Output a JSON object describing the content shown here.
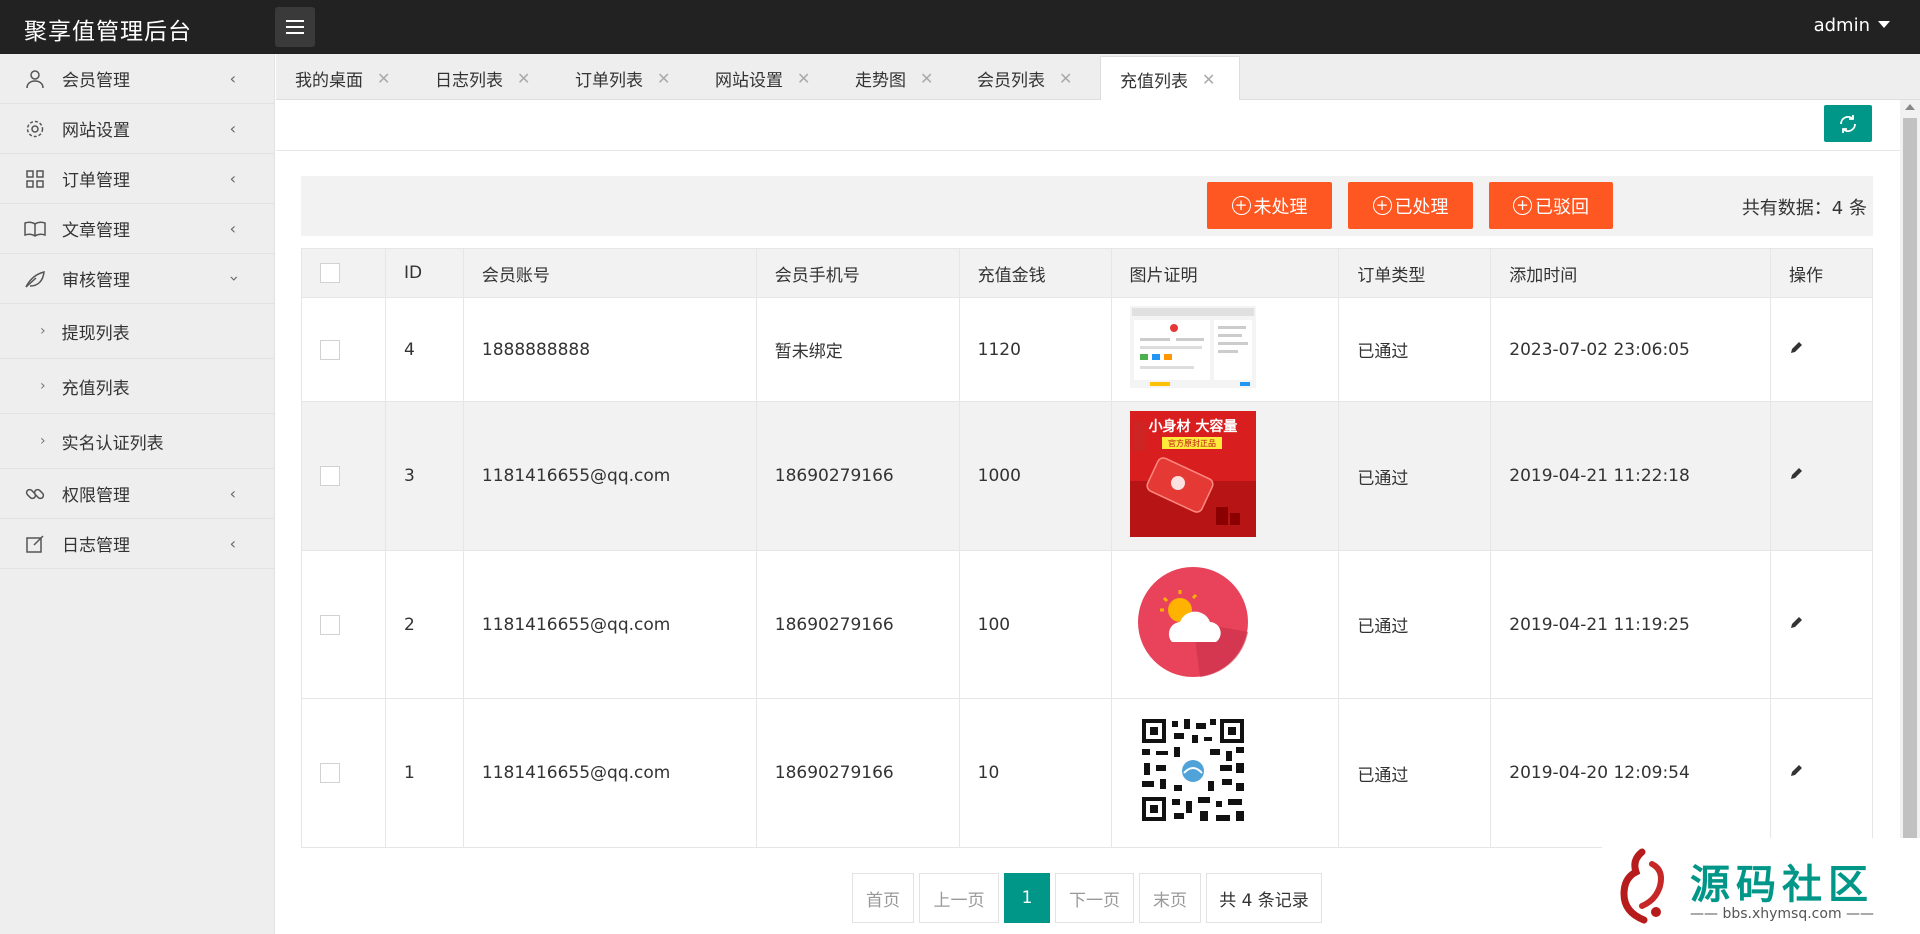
{
  "header": {
    "brand": "聚享值管理后台",
    "user": "admin"
  },
  "sidebar": {
    "items": [
      {
        "label": "会员管理"
      },
      {
        "label": "网站设置"
      },
      {
        "label": "订单管理"
      },
      {
        "label": "文章管理"
      },
      {
        "label": "审核管理"
      },
      {
        "label": "权限管理"
      },
      {
        "label": "日志管理"
      }
    ],
    "subitems": [
      {
        "label": "提现列表"
      },
      {
        "label": "充值列表"
      },
      {
        "label": "实名认证列表"
      }
    ]
  },
  "tabs": [
    {
      "label": "我的桌面"
    },
    {
      "label": "日志列表"
    },
    {
      "label": "订单列表"
    },
    {
      "label": "网站设置"
    },
    {
      "label": "走势图"
    },
    {
      "label": "会员列表"
    },
    {
      "label": "充值列表"
    }
  ],
  "toolbar": {
    "btn_unprocessed": "未处理",
    "btn_processed": "已处理",
    "btn_rejected": "已驳回",
    "total": "共有数据：4 条"
  },
  "table": {
    "headers": [
      "ID",
      "会员账号",
      "会员手机号",
      "充值金钱",
      "图片证明",
      "订单类型",
      "添加时间",
      "操作"
    ],
    "rows": [
      {
        "id": "4",
        "account": "1888888888",
        "phone": "暂未绑定",
        "amount": "1120",
        "type": "已通过",
        "time": "2023-07-02 23:06:05"
      },
      {
        "id": "3",
        "account": "1181416655@qq.com",
        "phone": "18690279166",
        "amount": "1000",
        "type": "已通过",
        "time": "2019-04-21 11:22:18"
      },
      {
        "id": "2",
        "account": "1181416655@qq.com",
        "phone": "18690279166",
        "amount": "100",
        "type": "已通过",
        "time": "2019-04-21 11:19:25"
      },
      {
        "id": "1",
        "account": "1181416655@qq.com",
        "phone": "18690279166",
        "amount": "10",
        "type": "已通过",
        "time": "2019-04-20 12:09:54"
      }
    ],
    "proof_banner_text": "小身材 大容量",
    "proof_banner_sub": "官方原封正品"
  },
  "pager": {
    "first": "首页",
    "prev": "上一页",
    "current": "1",
    "next": "下一页",
    "last": "末页",
    "info": "共 4 条记录"
  },
  "watermark": {
    "title": "源码社区",
    "url": "bbs.xhymsq.com"
  },
  "colors": {
    "header_bg": "#222222",
    "accent": "#009688",
    "action": "#ff5722"
  }
}
